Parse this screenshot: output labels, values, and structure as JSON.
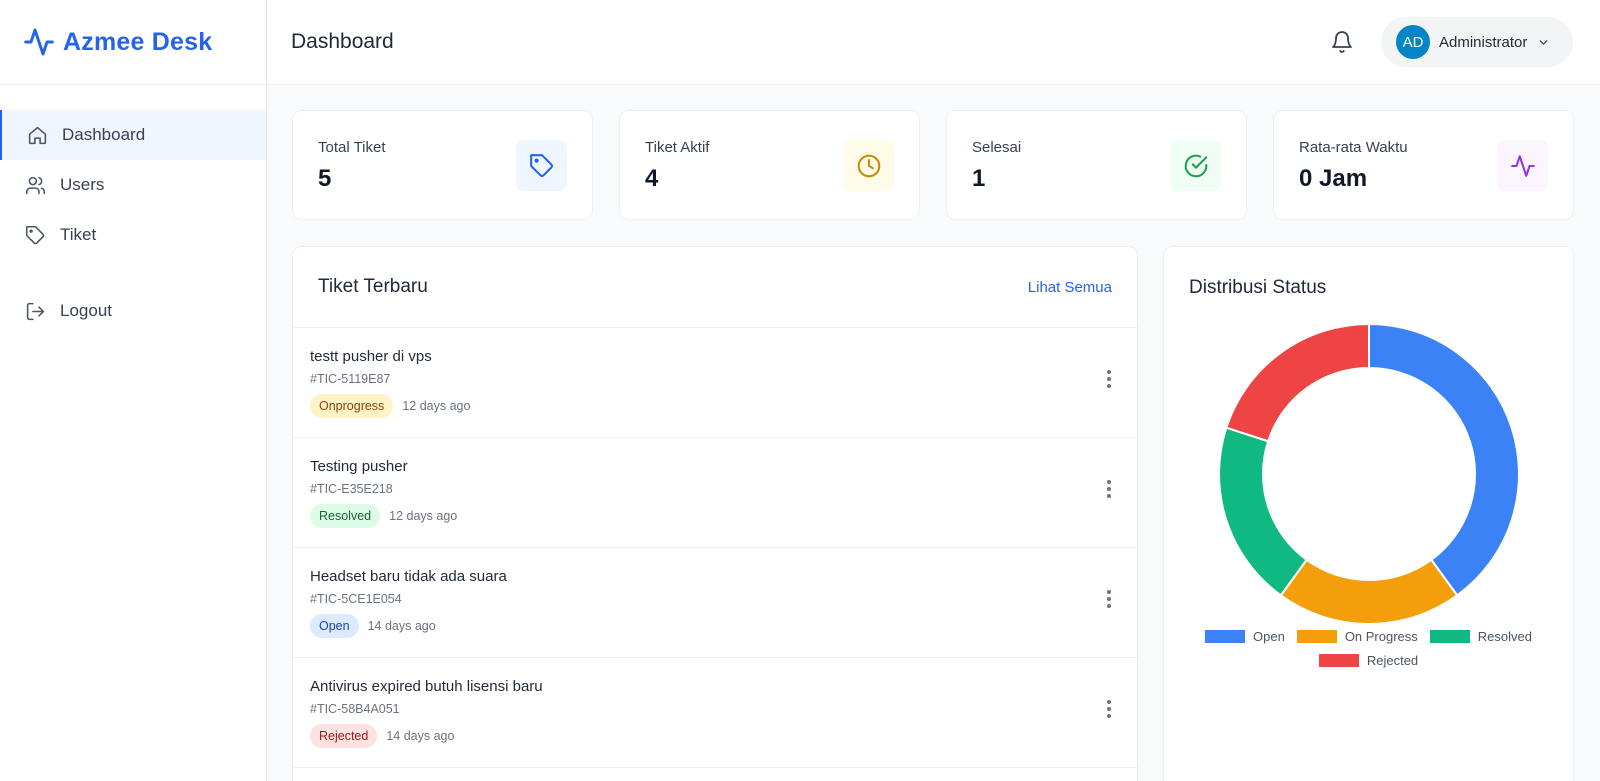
{
  "app": {
    "name": "Azmee Desk"
  },
  "sidebar": {
    "items": [
      {
        "label": "Dashboard",
        "icon": "home-icon",
        "active": true
      },
      {
        "label": "Users",
        "icon": "users-icon"
      },
      {
        "label": "Tiket",
        "icon": "tag-icon"
      }
    ],
    "logout": {
      "label": "Logout",
      "icon": "logout-icon"
    }
  },
  "header": {
    "title": "Dashboard",
    "user": {
      "initials": "AD",
      "name": "Administrator"
    }
  },
  "stats": [
    {
      "label": "Total Tiket",
      "value": "5",
      "icon": "tag-icon",
      "color": "#2563eb",
      "bg": "#eff6ff"
    },
    {
      "label": "Tiket Aktif",
      "value": "4",
      "icon": "clock-icon",
      "color": "#ca8a04",
      "bg": "#fefce8"
    },
    {
      "label": "Selesai",
      "value": "1",
      "icon": "check-circle-icon",
      "color": "#16a34a",
      "bg": "#f0fdf4"
    },
    {
      "label": "Rata-rata Waktu",
      "value": "0 Jam",
      "icon": "activity-icon",
      "color": "#9333ea",
      "bg": "#faf5ff"
    }
  ],
  "tickets": {
    "title": "Tiket Terbaru",
    "see_all": "Lihat Semua",
    "items": [
      {
        "title": "testt pusher di vps",
        "id": "#TIC-5119E87",
        "status": "Onprogress",
        "status_color": "#92400e",
        "status_bg": "#fef3c7",
        "time": "12 days ago"
      },
      {
        "title": "Testing pusher",
        "id": "#TIC-E35E218",
        "status": "Resolved",
        "status_color": "#166534",
        "status_bg": "#dcfce7",
        "time": "12 days ago"
      },
      {
        "title": "Headset baru tidak ada suara",
        "id": "#TIC-5CE1E054",
        "status": "Open",
        "status_color": "#1e40af",
        "status_bg": "#dbeafe",
        "time": "14 days ago"
      },
      {
        "title": "Antivirus expired butuh lisensi baru",
        "id": "#TIC-58B4A051",
        "status": "Rejected",
        "status_color": "#991b1b",
        "status_bg": "#fee2e2",
        "time": "14 days ago"
      }
    ]
  },
  "chart_data": {
    "type": "pie",
    "title": "Distribusi Status",
    "categories": [
      "Open",
      "On Progress",
      "Resolved",
      "Rejected"
    ],
    "values": [
      2,
      1,
      1,
      1
    ],
    "colors": [
      "#3b82f6",
      "#f59e0b",
      "#10b981",
      "#ef4444"
    ],
    "donut": true,
    "legend": "bottom"
  }
}
